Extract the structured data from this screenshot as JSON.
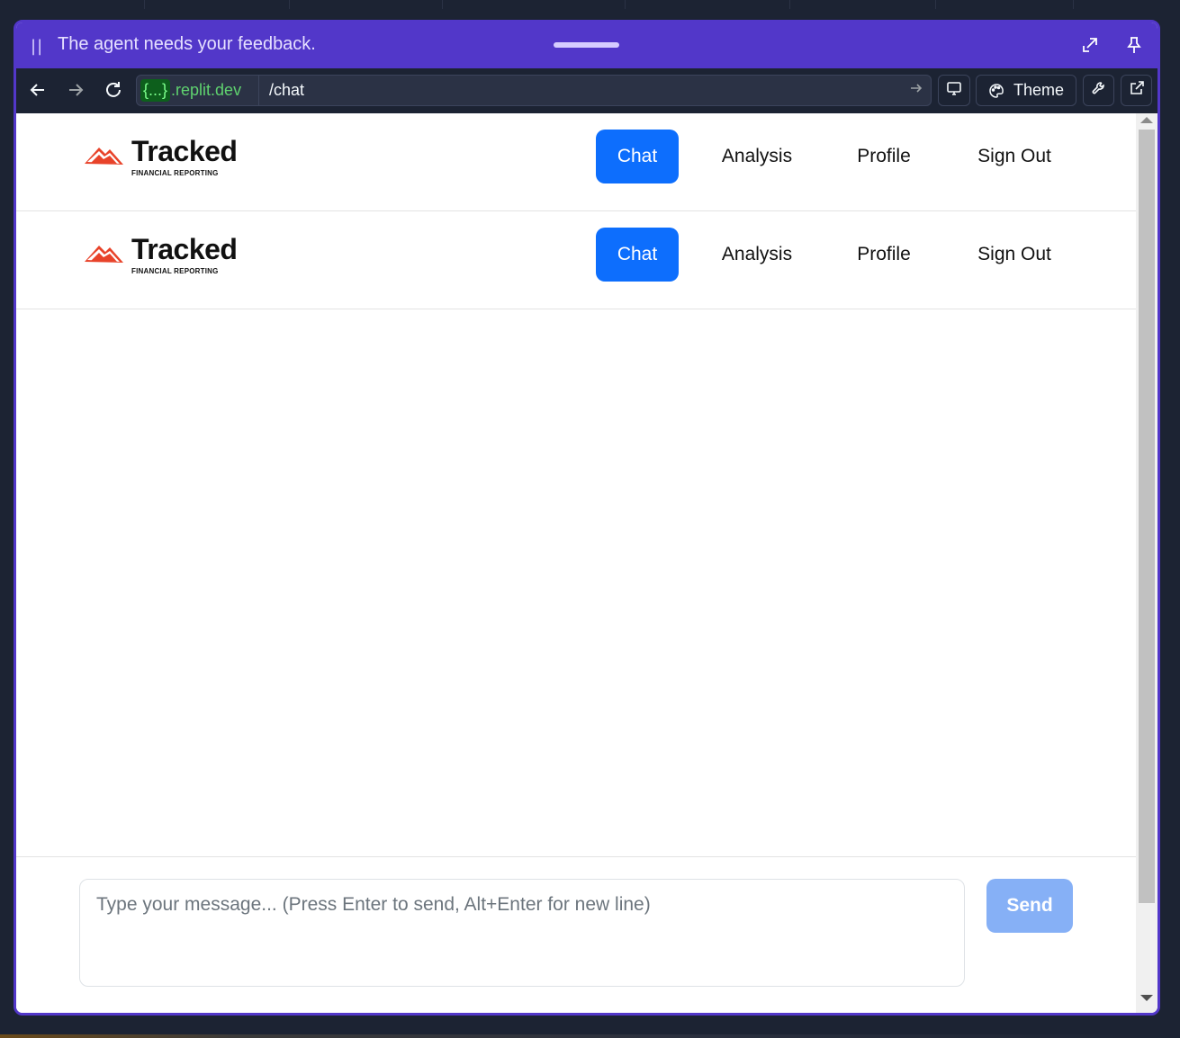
{
  "feedback_bar": {
    "pause_glyph": "||",
    "message": "The agent needs your feedback.",
    "icons": [
      "expand-arrow-icon",
      "pin-icon"
    ]
  },
  "browser": {
    "url_chip": "{...}",
    "url_domain": ".replit.dev",
    "url_path": "/chat",
    "theme_label": "Theme",
    "icons": [
      "back-arrow-icon",
      "forward-arrow-icon",
      "reload-icon",
      "go-arrow-icon",
      "device-icon",
      "palette-icon",
      "wrench-icon",
      "open-external-icon"
    ]
  },
  "navbar": {
    "brand": "Tracked",
    "brand_sub": "FINANCIAL REPORTING",
    "links": [
      "Chat",
      "Analysis",
      "Profile",
      "Sign Out"
    ],
    "active": "Chat"
  },
  "composer": {
    "placeholder": "Type your message... (Press Enter to send, Alt+Enter for new line)",
    "value": "",
    "send_label": "Send"
  },
  "colors": {
    "accent_purple": "#5237c9",
    "primary_blue": "#0d6efd",
    "send_disabled_blue": "#86b0f6",
    "chrome_dark": "#1c2333",
    "domain_green": "#5fd26f",
    "logo_orange": "#e8432a"
  }
}
